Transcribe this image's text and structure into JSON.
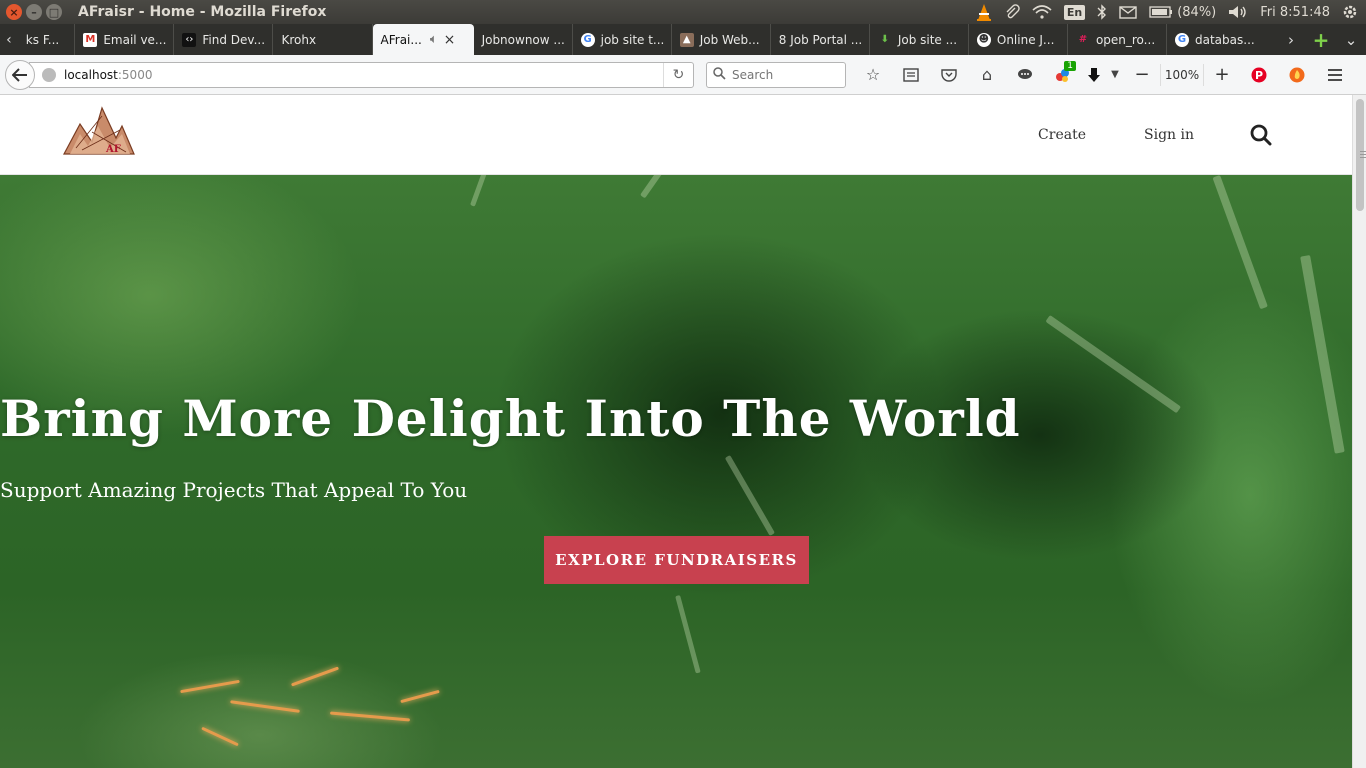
{
  "window": {
    "title": "AFraisr - Home - Mozilla Firefox",
    "controls": {
      "close": "×",
      "minimize": "–",
      "maximize": "□"
    }
  },
  "system_tray": {
    "input_method": "En",
    "battery": "(84%)",
    "clock": "Fri  8:51:48"
  },
  "tabs": [
    {
      "label": "ks F...",
      "icon": "generic-page-icon",
      "active": false
    },
    {
      "label": "Email ve...",
      "icon": "gmail-icon",
      "active": false
    },
    {
      "label": "Find Dev...",
      "icon": "code-icon",
      "active": false
    },
    {
      "label": "Krohx",
      "icon": "blank-icon",
      "active": false
    },
    {
      "label": "AFrai...",
      "icon": "blank-icon",
      "active": true
    },
    {
      "label": "Jobnownow ...",
      "icon": "blank-icon",
      "active": false
    },
    {
      "label": "job site t...",
      "icon": "google-icon",
      "active": false
    },
    {
      "label": "Job Web...",
      "icon": "site-icon",
      "active": false
    },
    {
      "label": "8 Job Portal ...",
      "icon": "blank-icon",
      "active": false
    },
    {
      "label": "Job site ...",
      "icon": "download-arrow-icon",
      "active": false
    },
    {
      "label": "Online J...",
      "icon": "site-icon",
      "active": false
    },
    {
      "label": "open_ro...",
      "icon": "hash-icon",
      "active": false
    },
    {
      "label": "databas...",
      "icon": "google-icon",
      "active": false
    }
  ],
  "navbar": {
    "url_host": "localhost",
    "url_port": ":5000",
    "search_placeholder": "Search",
    "zoom_level": "100%",
    "badge_count": "1"
  },
  "site": {
    "nav": {
      "create": "Create",
      "sign_in": "Sign in"
    },
    "logo_text": "AF"
  },
  "hero": {
    "title": "Bring More Delight Into The World",
    "subtitle": "Support Amazing Projects That Appeal To You",
    "cta": "EXPLORE FUNDRAISERS"
  },
  "colors": {
    "cta_background": "#c8414f",
    "hero_green": "#2f6a2a",
    "titlebar": "#3c3b37"
  }
}
